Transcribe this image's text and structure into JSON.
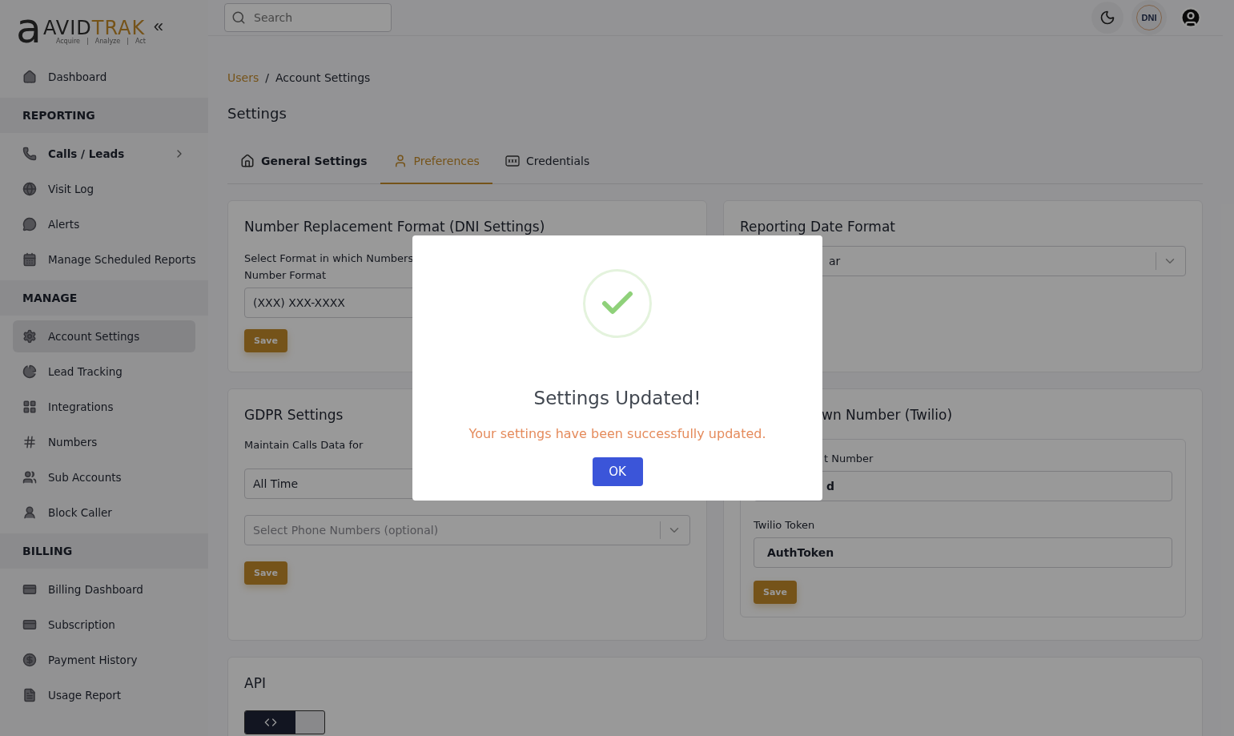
{
  "logo": {
    "mark": "a",
    "name_dark": "AVID",
    "name_accent": "TRAK",
    "tagline": [
      "Acquire",
      "|",
      "Analyze",
      "|",
      "Act"
    ],
    "collapse": "«"
  },
  "search": {
    "placeholder": "Search"
  },
  "header": {
    "badge": "DNI"
  },
  "sidebar": {
    "sections": [
      {
        "items": [
          {
            "label": "Dashboard",
            "kind": "link",
            "selected": false
          }
        ]
      },
      {
        "heading": "REPORTING",
        "items": [
          {
            "label": "Calls / Leads",
            "kind": "expandable",
            "selected": false
          },
          {
            "label": "Visit Log",
            "kind": "link",
            "selected": false
          },
          {
            "label": "Alerts",
            "kind": "link",
            "selected": false
          },
          {
            "label": "Manage Scheduled Reports",
            "kind": "link",
            "selected": false
          }
        ]
      },
      {
        "heading": "MANAGE",
        "items": [
          {
            "label": "Account Settings",
            "kind": "link",
            "selected": true
          },
          {
            "label": "Lead Tracking",
            "kind": "link",
            "selected": false
          },
          {
            "label": "Integrations",
            "kind": "link",
            "selected": false
          },
          {
            "label": "Numbers",
            "kind": "link",
            "selected": false
          },
          {
            "label": "Sub Accounts",
            "kind": "link",
            "selected": false
          },
          {
            "label": "Block Caller",
            "kind": "link",
            "selected": false
          }
        ]
      },
      {
        "heading": "BILLING",
        "items": [
          {
            "label": "Billing Dashboard",
            "kind": "link",
            "selected": false
          },
          {
            "label": "Subscription",
            "kind": "link",
            "selected": false
          },
          {
            "label": "Payment History",
            "kind": "link",
            "selected": false
          },
          {
            "label": "Usage Report",
            "kind": "link",
            "selected": false
          }
        ]
      }
    ]
  },
  "breadcrumb": {
    "separator": "/",
    "items": [
      {
        "label": "Users",
        "kind": "link"
      },
      {
        "label": "Account Settings",
        "kind": "current"
      }
    ]
  },
  "page_title": "Settings",
  "tabs": [
    {
      "label": "General Settings",
      "emphasized": true,
      "selected": false
    },
    {
      "label": "Preferences",
      "emphasized": false,
      "selected": true
    },
    {
      "label": "Credentials",
      "emphasized": false,
      "selected": false
    }
  ],
  "dni_card": {
    "title": "Number Replacement Format (DNI Settings)",
    "description": "Select Format in which Numbers",
    "field_label": "Number Format",
    "value": "(XXX) XXX-XXXX",
    "button": "Save"
  },
  "date_card": {
    "title": "Reporting Date Format",
    "value": "ar"
  },
  "gdpr_card": {
    "title": "GDPR Settings",
    "field_label": "Maintain Calls Data for",
    "value": "All Time",
    "numbers_placeholder": "Select Phone Numbers (optional)",
    "button": "Save"
  },
  "twilio_card": {
    "title": "wn Number (Twilio)",
    "sid_label": "t Number",
    "sid_value": "d",
    "token_label": "Twilio Token",
    "token_value": "AuthToken",
    "button": "Save"
  },
  "api_card": {
    "title": "API"
  },
  "modal": {
    "title": "Settings Updated!",
    "message": "Your settings have been successfully updated.",
    "button": "OK"
  }
}
